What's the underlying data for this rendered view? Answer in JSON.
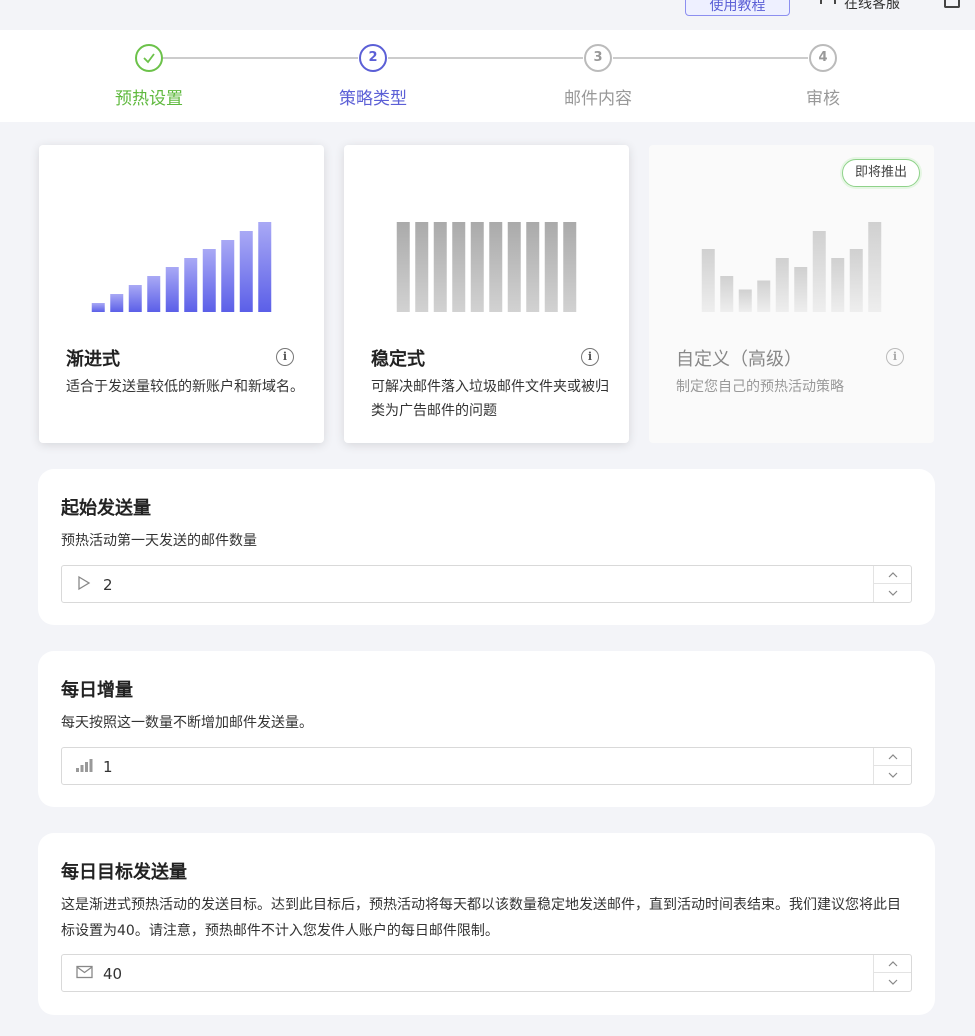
{
  "topbar": {
    "tutorial_label": "使用教程",
    "service_label": "在线客服"
  },
  "stepper": {
    "steps": [
      {
        "number": "✓",
        "label": "预热设置",
        "state": "done"
      },
      {
        "number": "2",
        "label": "策略类型",
        "state": "active"
      },
      {
        "number": "3",
        "label": "邮件内容",
        "state": "pending"
      },
      {
        "number": "4",
        "label": "审核",
        "state": "pending"
      }
    ]
  },
  "strategies": [
    {
      "title": "渐进式",
      "description": "适合于发送量较低的新账户和新域名。",
      "info_icon": "info-circle-icon",
      "bar_values": [
        1,
        2,
        3,
        4,
        5,
        6,
        7,
        8,
        9,
        10
      ],
      "bar_color_start": "#a9a9f5",
      "bar_color_end": "#5b5fe8"
    },
    {
      "title": "稳定式",
      "description": "可解决邮件落入垃圾邮件文件夹或被归类为广告邮件的问题",
      "info_icon": "info-circle-icon",
      "bar_values": [
        10,
        10,
        10,
        10,
        10,
        10,
        10,
        10,
        10,
        10
      ],
      "bar_color_start": "#aaaaaa",
      "bar_color_end": "#d2d2d2"
    },
    {
      "title": "自定义（高级）",
      "description": "制定您自己的预热活动策略",
      "info_icon": "info-circle-icon",
      "badge": "即将推出",
      "bar_values": [
        7,
        4,
        2.5,
        3.5,
        6,
        5,
        9,
        6,
        7,
        10
      ],
      "bar_color_start": "#d0d0d0",
      "bar_color_end": "#eeeeee"
    }
  ],
  "fields": {
    "start_volume": {
      "title": "起始发送量",
      "description": "预热活动第一天发送的邮件数量",
      "value": "2",
      "icon": "play-outline-icon"
    },
    "daily_increase": {
      "title": "每日增量",
      "description": "每天按照这一数量不断增加邮件发送量。",
      "value": "1",
      "icon": "signal-bars-icon"
    },
    "daily_target": {
      "title": "每日目标发送量",
      "description": "这是渐进式预热活动的发送目标。达到此目标后，预热活动将每天都以该数量稳定地发送邮件，直到活动时间表结束。我们建议您将此目标设置为40。请注意，预热邮件不计入您发件人账户的每日邮件限制。",
      "value": "40",
      "icon": "mail-icon"
    }
  },
  "colors": {
    "accent": "#5b5fd6",
    "done": "#5fb93e",
    "pending": "#999999"
  }
}
